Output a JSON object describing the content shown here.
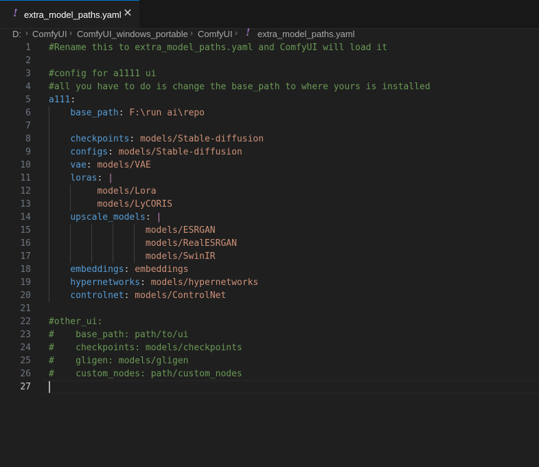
{
  "tab": {
    "icon": "yaml-exclamation-icon",
    "icon_glyph": "!",
    "filename": "extra_model_paths.yaml",
    "close_glyph": "✕"
  },
  "breadcrumb": {
    "items": [
      "D:",
      "ComfyUI",
      "ComfyUI_windows_portable",
      "ComfyUI",
      "extra_model_paths.yaml"
    ],
    "separator": "›",
    "file_icon_glyph": "!"
  },
  "editor": {
    "language": "yaml",
    "cursor_line": 27,
    "colors": {
      "comment": "#6a9955",
      "key": "#569cd6",
      "value": "#ce9178",
      "block_indicator": "#c586c0"
    },
    "lines": [
      {
        "n": "1",
        "comment": "#Rename this to extra_model_paths.yaml and ComfyUI will load it"
      },
      {
        "n": "2"
      },
      {
        "n": "3",
        "comment": "#config for a1111 ui"
      },
      {
        "n": "4",
        "comment": "#all you have to do is change the base_path to where yours is installed"
      },
      {
        "n": "5",
        "key": "a111",
        "colon": ":"
      },
      {
        "n": "6",
        "indent": "    ",
        "key": "base_path",
        "colon": ": ",
        "value": "F:\\run ai\\repo"
      },
      {
        "n": "7"
      },
      {
        "n": "8",
        "indent": "    ",
        "key": "checkpoints",
        "colon": ": ",
        "value": "models/Stable-diffusion"
      },
      {
        "n": "9",
        "indent": "    ",
        "key": "configs",
        "colon": ": ",
        "value": "models/Stable-diffusion"
      },
      {
        "n": "10",
        "indent": "    ",
        "key": "vae",
        "colon": ": ",
        "value": "models/VAE"
      },
      {
        "n": "11",
        "indent": "    ",
        "key": "loras",
        "colon": ": ",
        "block": "|"
      },
      {
        "n": "12",
        "indent": "         ",
        "value": "models/Lora"
      },
      {
        "n": "13",
        "indent": "         ",
        "value": "models/LyCORIS"
      },
      {
        "n": "14",
        "indent": "    ",
        "key": "upscale_models",
        "colon": ": ",
        "block": "|"
      },
      {
        "n": "15",
        "indent": "                  ",
        "value": "models/ESRGAN"
      },
      {
        "n": "16",
        "indent": "                  ",
        "value": "models/RealESRGAN"
      },
      {
        "n": "17",
        "indent": "                  ",
        "value": "models/SwinIR"
      },
      {
        "n": "18",
        "indent": "    ",
        "key": "embeddings",
        "colon": ": ",
        "value": "embeddings"
      },
      {
        "n": "19",
        "indent": "    ",
        "key": "hypernetworks",
        "colon": ": ",
        "value": "models/hypernetworks"
      },
      {
        "n": "20",
        "indent": "    ",
        "key": "controlnet",
        "colon": ": ",
        "value": "models/ControlNet"
      },
      {
        "n": "21"
      },
      {
        "n": "22",
        "comment": "#other_ui:"
      },
      {
        "n": "23",
        "comment": "#    base_path: path/to/ui"
      },
      {
        "n": "24",
        "comment": "#    checkpoints: models/checkpoints"
      },
      {
        "n": "25",
        "comment": "#    gligen: models/gligen"
      },
      {
        "n": "26",
        "comment": "#    custom_nodes: path/custom_nodes"
      },
      {
        "n": "27"
      }
    ]
  }
}
